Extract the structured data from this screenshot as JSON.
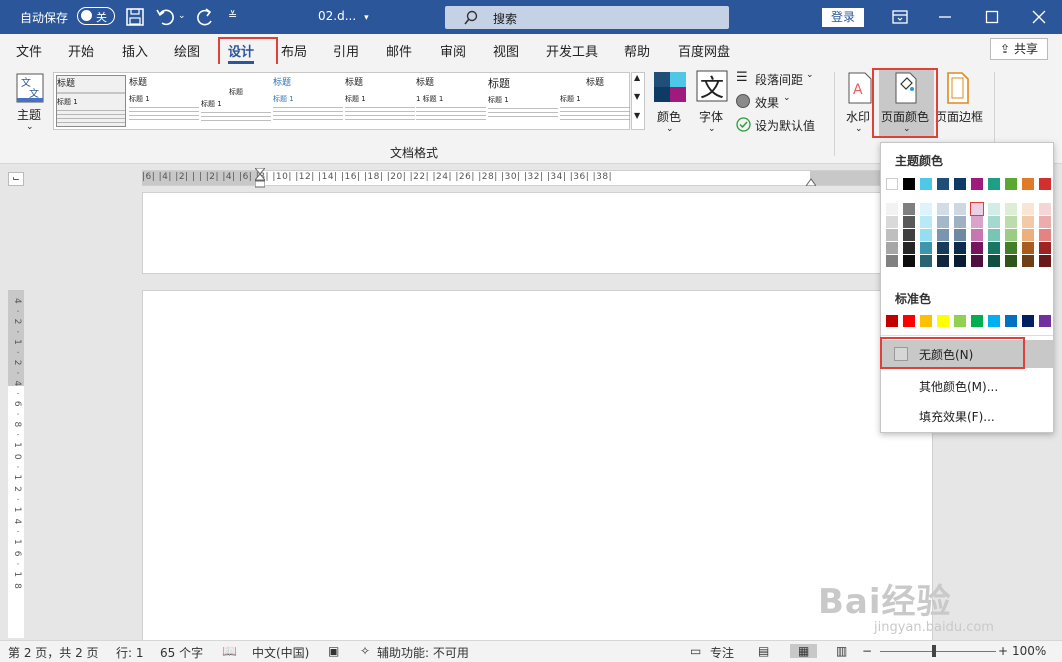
{
  "titlebar": {
    "autosave_label": "自动保存",
    "autosave_state": "关",
    "doc_title": "02.d...",
    "search_placeholder": "搜索",
    "login_label": "登录"
  },
  "tabs": [
    {
      "label": "文件"
    },
    {
      "label": "开始"
    },
    {
      "label": "插入"
    },
    {
      "label": "绘图"
    },
    {
      "label": "设计"
    },
    {
      "label": "布局"
    },
    {
      "label": "引用"
    },
    {
      "label": "邮件"
    },
    {
      "label": "审阅"
    },
    {
      "label": "视图"
    },
    {
      "label": "开发工具"
    },
    {
      "label": "帮助"
    },
    {
      "label": "百度网盘"
    }
  ],
  "share_label": "共享",
  "ribbon": {
    "theme_label": "主题",
    "gallery": [
      {
        "title": "标题",
        "h": "标题 1"
      },
      {
        "title": "标题",
        "h": "标题 1"
      },
      {
        "title": "标题",
        "h": "标题 1"
      },
      {
        "title": "标题",
        "h": "标题 1"
      },
      {
        "title": "标题",
        "h": "标题 1"
      },
      {
        "title": "标题",
        "h": "1  标题 1"
      },
      {
        "title": "标题",
        "h": "标题 1"
      },
      {
        "title": "标题",
        "h": "标题 1"
      }
    ],
    "doc_format_label": "文档格式",
    "colors_label": "颜色",
    "fonts_label": "字体",
    "para_spacing_label": "段落间距",
    "effects_label": "效果",
    "set_default_label": "设为默认值",
    "watermark_label": "水印",
    "page_color_label": "页面颜色",
    "page_border_label": "页面边框"
  },
  "dropdown": {
    "theme_colors_header": "主题颜色",
    "standard_colors_header": "标准色",
    "no_color_label": "无颜色(N)",
    "more_colors_label": "其他颜色(M)...",
    "fill_effects_label": "填充效果(F)...",
    "theme_top_row": [
      "#ffffff",
      "#000000",
      "#4fc8e8",
      "#1f4e79",
      "#103a66",
      "#a01a7d",
      "#1e9e84",
      "#5aa832",
      "#e07b28",
      "#d32f2f"
    ],
    "standard_row": [
      "#c00000",
      "#ff0000",
      "#ffc000",
      "#ffff00",
      "#92d050",
      "#00b050",
      "#00b0f0",
      "#0070c0",
      "#002060",
      "#7030a0"
    ]
  },
  "statusbar": {
    "page": "第 2 页，共 2 页",
    "line": "行: 1",
    "words": "65 个字",
    "language": "中文(中国)",
    "accessibility": "辅助功能: 不可用",
    "focus": "专注",
    "zoom": "100%"
  },
  "watermark": {
    "big": "Bai经验",
    "small": "jingyan.baidu.com"
  }
}
